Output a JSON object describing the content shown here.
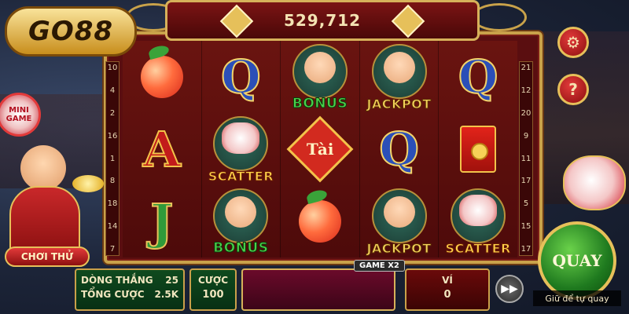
{
  "brand": {
    "logo_text": "GO88"
  },
  "jackpot": {
    "value": "529,712"
  },
  "pay_lines": {
    "left": [
      "10",
      "4",
      "2",
      "16",
      "1",
      "8",
      "18",
      "14",
      "7"
    ],
    "right": [
      "21",
      "12",
      "20",
      "9",
      "11",
      "17",
      "5",
      "15",
      "17"
    ]
  },
  "reels": [
    [
      {
        "symbol": "peach",
        "label": ""
      },
      {
        "symbol": "A",
        "label": ""
      },
      {
        "symbol": "J",
        "label": ""
      }
    ],
    [
      {
        "symbol": "Q",
        "label": ""
      },
      {
        "symbol": "scatter",
        "label": "SCATTER"
      },
      {
        "symbol": "bonus",
        "label": "BONUS"
      }
    ],
    [
      {
        "symbol": "bonus",
        "label": "BONUS"
      },
      {
        "symbol": "tai",
        "label": "Tài"
      },
      {
        "symbol": "peach",
        "label": ""
      }
    ],
    [
      {
        "symbol": "jackpot",
        "label": "JACKPOT"
      },
      {
        "symbol": "Q",
        "label": ""
      },
      {
        "symbol": "jackpot",
        "label": "JACKPOT"
      }
    ],
    [
      {
        "symbol": "Q",
        "label": ""
      },
      {
        "symbol": "envelope",
        "label": ""
      },
      {
        "symbol": "scatter",
        "label": "SCATTER"
      }
    ]
  ],
  "side_buttons": {
    "settings_icon": "gear-icon",
    "help_label": "?",
    "mini_game_label_1": "MINI",
    "mini_game_label_2": "GAME"
  },
  "try_button": {
    "label": "CHƠI THỬ"
  },
  "bottom_bar": {
    "lines_label": "DÒNG THẮNG",
    "lines_value": "25",
    "total_bet_label": "TỔNG CƯỢC",
    "total_bet_value": "2.5K",
    "bet_label": "CƯỢC",
    "bet_value": "100",
    "game_badge": "GAME X2",
    "wallet_label": "VÍ",
    "wallet_value": "0",
    "fast_forward_icon": "fast-forward-icon",
    "spin_label": "QUAY",
    "auto_spin_hint": "Giữ để tự quay"
  },
  "colors": {
    "frame_gold": "#c9a24a",
    "reel_red": "#5a0e10",
    "spin_green": "#1f7a1f"
  }
}
